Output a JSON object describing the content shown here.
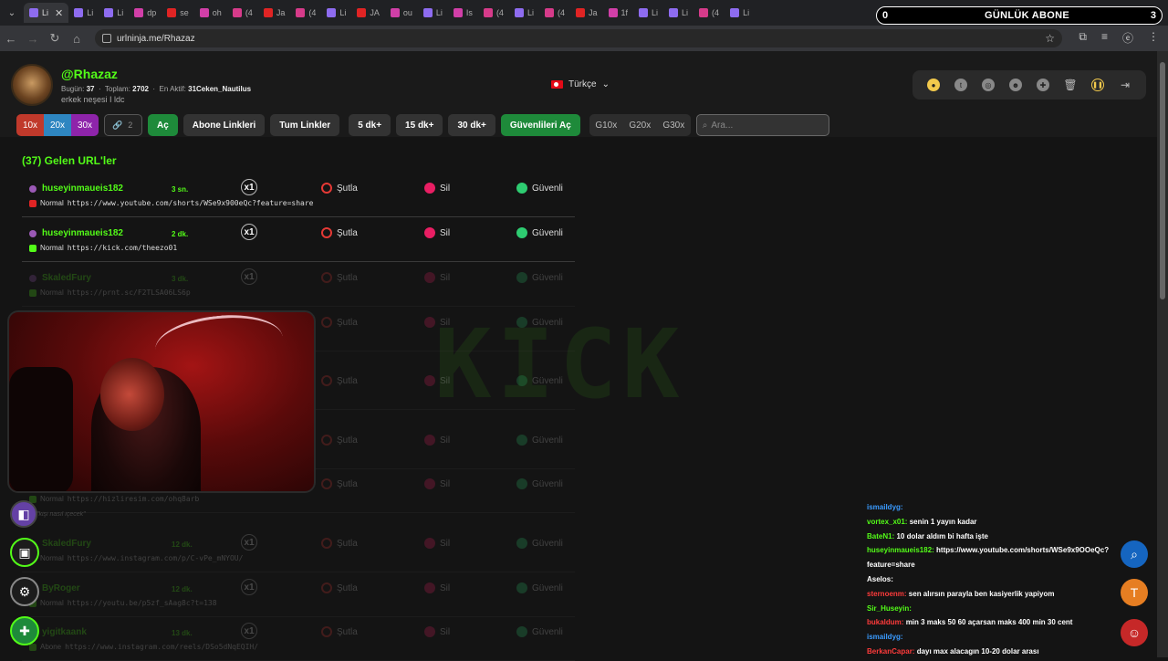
{
  "browser": {
    "tabs": [
      {
        "label": "Li",
        "color": "#8e6cf0",
        "active": true
      },
      {
        "label": "Li",
        "color": "#8e6cf0"
      },
      {
        "label": "Li",
        "color": "#8e6cf0"
      },
      {
        "label": "dp",
        "color": "#d13fa8"
      },
      {
        "label": "se",
        "color": "#e02424"
      },
      {
        "label": "oh",
        "color": "#d13fa8"
      },
      {
        "label": "(4",
        "color": "#d63b8a"
      },
      {
        "label": "Ja",
        "color": "#e02424"
      },
      {
        "label": "(4",
        "color": "#d63b8a"
      },
      {
        "label": "Li",
        "color": "#8e6cf0"
      },
      {
        "label": "JA",
        "color": "#e02424"
      },
      {
        "label": "ou",
        "color": "#d13fa8"
      },
      {
        "label": "Li",
        "color": "#8e6cf0"
      },
      {
        "label": "Is",
        "color": "#d13fa8"
      },
      {
        "label": "(4",
        "color": "#d63b8a"
      },
      {
        "label": "Li",
        "color": "#8e6cf0"
      },
      {
        "label": "(4",
        "color": "#d63b8a"
      },
      {
        "label": "Ja",
        "color": "#e02424"
      },
      {
        "label": "1f",
        "color": "#d13fa8"
      },
      {
        "label": "Li",
        "color": "#8e6cf0"
      },
      {
        "label": "Li",
        "color": "#8e6cf0"
      },
      {
        "label": "(4",
        "color": "#d63b8a"
      },
      {
        "label": "Li",
        "color": "#8e6cf0"
      }
    ],
    "abone_left": "0",
    "abone_title": "GÜNLÜK ABONE",
    "abone_right": "3",
    "url": "urlninja.me/Rhazaz"
  },
  "profile": {
    "username": "@Rhazaz",
    "today_label": "Bugün:",
    "today_value": "37",
    "total_label": "Toplam:",
    "total_value": "2702",
    "active_label": "En Aktif:",
    "active_value": "31Ceken_Nautilus",
    "bio": "erkek neşesi I ldc",
    "language": "Türkçe"
  },
  "toolbar": {
    "mult": [
      "10x",
      "20x",
      "30x"
    ],
    "mult_colors": [
      "#c0392b",
      "#2e86c1",
      "#8e24aa"
    ],
    "link_count": "2",
    "open": "Aç",
    "sub_links": "Abone Linkleri",
    "all_links": "Tum Linkler",
    "t5": "5 dk+",
    "t15": "15 dk+",
    "t30": "30 dk+",
    "safe_open": "Güvenlileri Aç",
    "g10": "G10x",
    "g20": "G20x",
    "g30": "G30x",
    "search_placeholder": "Ara..."
  },
  "list": {
    "title": "(37) Gelen URL'ler",
    "skip": "Şutla",
    "delete": "Sil",
    "safe": "Güvenli",
    "rows": [
      {
        "user": "huseyinmaueis182",
        "ago": "3 sn.",
        "mult": "x1",
        "type": "Normal",
        "url": "https://www.youtube.com/shorts/WSe9x900eQc?feature=share",
        "src": "#e02424",
        "faded": false
      },
      {
        "user": "huseyinmaueis182",
        "ago": "2 dk.",
        "mult": "x1",
        "type": "Normal",
        "url": "https://kick.com/theezo01",
        "src": "#53fc18",
        "faded": false
      },
      {
        "user": "SkaledFury",
        "ago": "3 dk.",
        "mult": "x1",
        "type": "Normal",
        "url": "https://prnt.sc/F2TLSA06LS6p",
        "src": "#53fc18",
        "faded": true
      },
      {
        "user": "",
        "ago": "",
        "mult": "",
        "type": "",
        "url": "",
        "src": "#53fc18",
        "faded": true
      },
      {
        "user": "",
        "ago": "",
        "mult": "",
        "type": "",
        "url": "",
        "src": "#53fc18",
        "faded": true
      },
      {
        "user": "",
        "ago": "",
        "mult": "",
        "type": "",
        "url": "",
        "src": "#53fc18",
        "faded": true
      },
      {
        "user": "",
        "ago": "",
        "mult": "",
        "type": "Normal",
        "url": "https://hizliresim.com/ohq8arb",
        "src": "#53fc18",
        "faded": true
      },
      {
        "user": "SkaledFury",
        "ago": "12 dk.",
        "mult": "x1",
        "type": "Normal",
        "url": "https://www.instagram.com/p/C-vPe_mNYOU/",
        "src": "#53fc18",
        "faded": true
      },
      {
        "user": "ByRoger",
        "ago": "12 dk.",
        "mult": "x1",
        "type": "Normal",
        "url": "https://youtu.be/p5zf_sAag8c?t=138",
        "src": "#53fc18",
        "faded": true
      },
      {
        "user": "yigitkaank",
        "ago": "13 dk.",
        "mult": "x1",
        "type": "Abone",
        "url": "https://www.instagram.com/reels/DSo5dNqEQIH/",
        "src": "#53fc18",
        "faded": true
      }
    ],
    "note": "\"kişi nasıl içecek\""
  },
  "chat": [
    {
      "name": "ismaildyg:",
      "color": "#3a9bff",
      "text": ""
    },
    {
      "name": "vortex_x01:",
      "color": "#53fc18",
      "text": "senin 1 yayın kadar"
    },
    {
      "name": "BateN1:",
      "color": "#53fc18",
      "text": "10 dolar aldım bi hafta işte"
    },
    {
      "name": "huseyinmaueis182:",
      "color": "#53fc18",
      "text": "https://www.youtube.com/shorts/WSe9x9OOeQc?feature=share"
    },
    {
      "name": "Aselos:",
      "color": "#ffffff",
      "text": ""
    },
    {
      "name": "sternoenm:",
      "color": "#ff3b3b",
      "text": "sen alırsın parayla ben kasiyerlik yapiyom"
    },
    {
      "name": "Sir_Huseyin:",
      "color": "#53fc18",
      "text": ""
    },
    {
      "name": "bukaldum:",
      "color": "#ff3b3b",
      "text": "min 3 maks 50 60 açarsan maks 400 min 30 cent"
    },
    {
      "name": "ismaildyg:",
      "color": "#3a9bff",
      "text": ""
    },
    {
      "name": "BerkanCapar:",
      "color": "#ff3b3b",
      "text": "dayı max alacagın 10-20 dolar arası"
    }
  ],
  "colors": {
    "kick_green": "#53fc18",
    "bg": "#141414"
  }
}
